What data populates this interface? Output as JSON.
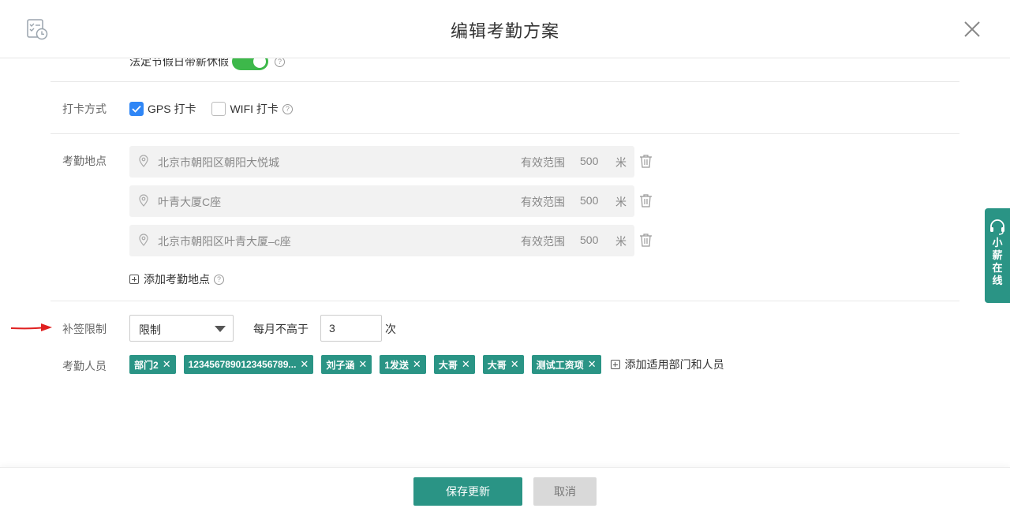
{
  "header": {
    "title": "编辑考勤方案"
  },
  "holiday": {
    "label": "法定节假日带薪休假",
    "enabled": true
  },
  "punch_method": {
    "label": "打卡方式",
    "options": [
      {
        "label": "GPS 打卡",
        "checked": true
      },
      {
        "label": "WIFI 打卡",
        "checked": false
      }
    ]
  },
  "locations": {
    "label": "考勤地点",
    "range_label": "有效范围",
    "unit": "米",
    "items": [
      {
        "name": "北京市朝阳区朝阳大悦城",
        "range": "500"
      },
      {
        "name": "叶青大厦C座",
        "range": "500"
      },
      {
        "name": "北京市朝阳区叶青大厦–c座",
        "range": "500"
      }
    ],
    "add_label": "添加考勤地点"
  },
  "makeup": {
    "label": "补签限制",
    "select_value": "限制",
    "monthly_label": "每月不高于",
    "count": "3",
    "times_unit": "次"
  },
  "people": {
    "label": "考勤人员",
    "tags": [
      "部门2",
      "1234567890123456789...",
      "刘子涵",
      "1发送",
      "大哥",
      "大哥",
      "测试工资项"
    ],
    "add_label": "添加适用部门和人员"
  },
  "side_widget": {
    "text": "小薪在线"
  },
  "footer": {
    "save_label": "保存更新",
    "cancel_label": "取消"
  },
  "colors": {
    "primary": "#2a9485",
    "switch_on": "#3db84a",
    "checkbox": "#2f86f6",
    "arrow": "#e02020"
  }
}
